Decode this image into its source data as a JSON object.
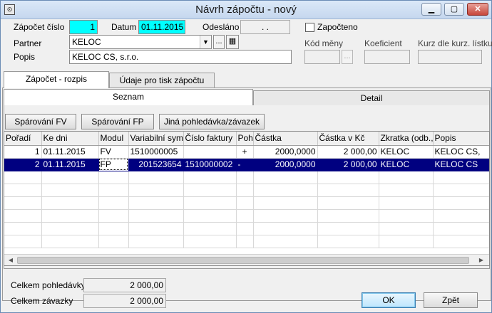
{
  "window": {
    "title": "Návrh zápočtu - nový",
    "app_icon": "app-icon",
    "controls": {
      "minimize": "minimize-icon",
      "maximize": "maximize-icon",
      "close": "close-icon"
    }
  },
  "header": {
    "zapocet_cislo_label": "Zápočet číslo",
    "zapocet_cislo_value": "1",
    "datum_label": "Datum",
    "datum_value": "01.11.2015",
    "odeslano_label": "Odesláno",
    "odeslano_value": ". .",
    "zapocteno_label": "Započteno",
    "zapocteno_checked": false,
    "partner_label": "Partner",
    "partner_value": "KELOC",
    "partner_browse": "...",
    "popis_label": "Popis",
    "popis_value": "KELOC CS, s.r.o.",
    "kod_meny_label": "Kód měny",
    "kod_meny_value": "",
    "kod_meny_browse": "...",
    "koeficient_label": "Koeficient",
    "koeficient_value": "",
    "kurz_label": "Kurz dle kurz. lístku",
    "kurz_value": ""
  },
  "tabs": [
    {
      "label": "Zápočet - rozpis",
      "active": true
    },
    {
      "label": "Údaje pro tisk zápočtu",
      "active": false
    }
  ],
  "subtabs": [
    {
      "label": "Seznam",
      "active": true
    },
    {
      "label": "Detail",
      "active": false
    }
  ],
  "actions": {
    "sparovani_fv": "Spárování FV",
    "sparovani_fp": "Spárování FP",
    "jina": "Jiná pohledávka/závazek"
  },
  "table": {
    "columns": [
      "Pořadí",
      "Ke dni",
      "Modul",
      "Variabilní sym",
      "Číslo faktury",
      "Poh",
      "Částka",
      "Částka v Kč",
      "Zkratka (odb.,",
      "Popis"
    ],
    "rows": [
      [
        "1",
        "01.11.2015",
        "FV",
        "1510000005",
        "",
        "+",
        "2000,0000",
        "2 000,00",
        "KELOC",
        "KELOC CS,"
      ],
      [
        "2",
        "01.11.2015",
        "FP",
        "201523654",
        "1510000002",
        "-",
        "2000,0000",
        "2 000,00",
        "KELOC",
        "KELOC CS"
      ]
    ],
    "selected_row": 2
  },
  "totals": {
    "pohledavky_label": "Celkem pohledávky",
    "pohledavky_value": "2 000,00",
    "zavazky_label": "Celkem závazky",
    "zavazky_value": "2 000,00"
  },
  "buttons": {
    "ok": "OK",
    "zpet": "Zpět"
  }
}
